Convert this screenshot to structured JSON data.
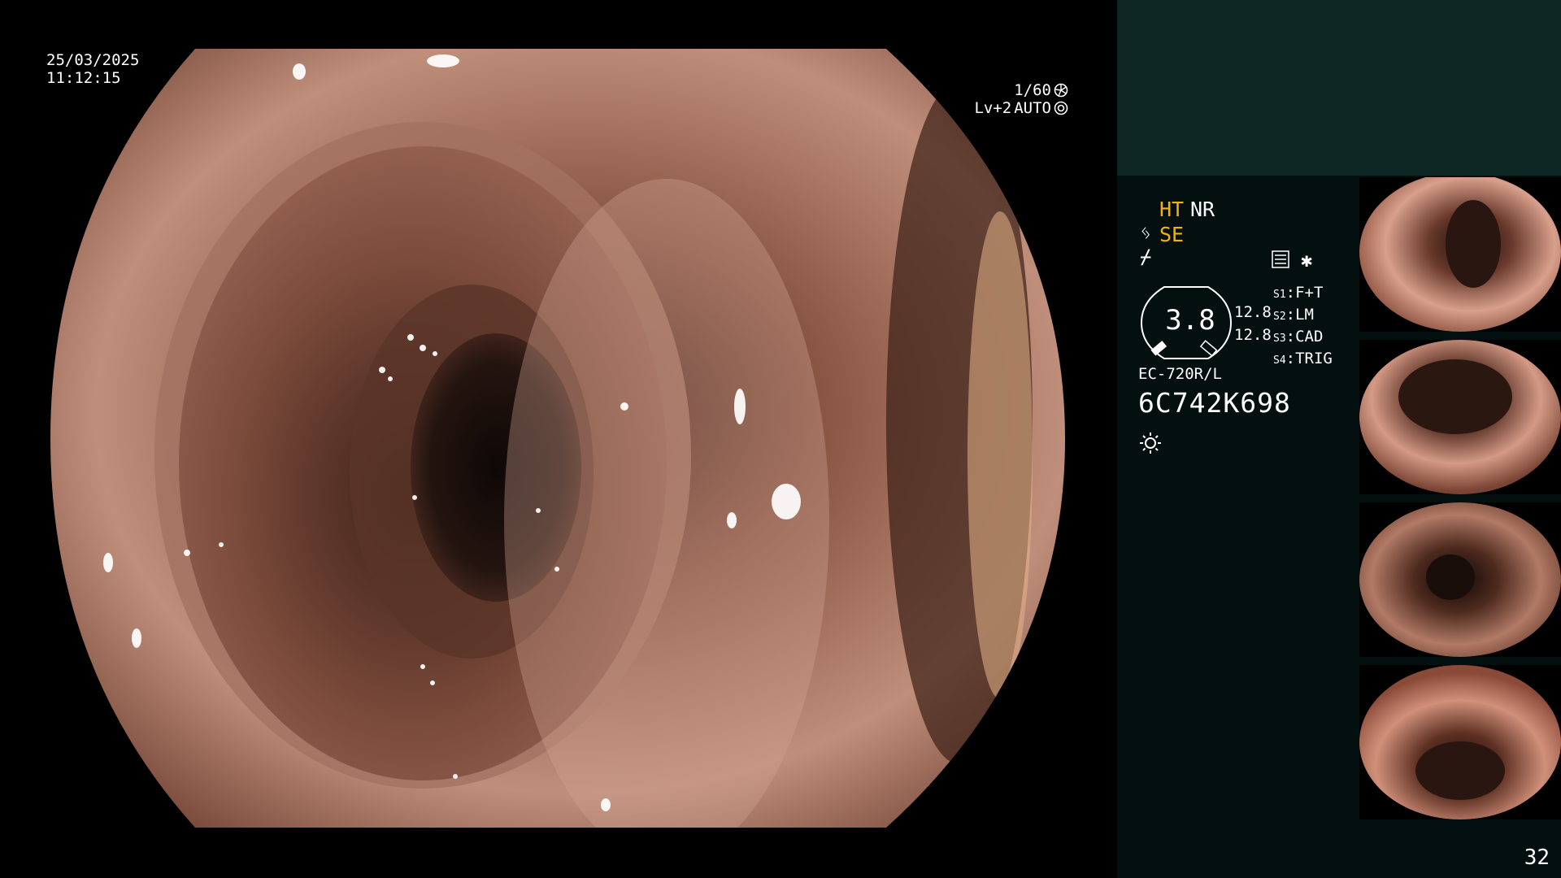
{
  "overlay": {
    "date": "25/03/2025",
    "time": "11:12:15",
    "shutter": "1/60",
    "level": "Lv+2",
    "exposure_mode": "AUTO"
  },
  "panel": {
    "ht_label": "HT",
    "nr_label": "NR",
    "se_label": "SE",
    "zoom_value": "3.8",
    "zoom_sub_1": "12.8",
    "zoom_sub_2": "12.8",
    "modes": [
      {
        "key": "S1",
        "value": "F+T"
      },
      {
        "key": "S2",
        "value": "LM"
      },
      {
        "key": "S3",
        "value": "CAD"
      },
      {
        "key": "S4",
        "value": "TRIG"
      }
    ],
    "scope_model": "EC-720R/L",
    "serial": "6C742K698",
    "frame_count": "32"
  },
  "icons": {
    "shutter": "shutter-icon",
    "iris": "iris-icon",
    "se_symbol": "structure-enhancement-icon",
    "check_symbol": "color-check-icon",
    "settings": "settings-list-icon",
    "asterisk": "asterisk-icon",
    "zoom": "zoom-dial-icon",
    "light": "light-source-icon"
  },
  "colors": {
    "accent": "#f2b400",
    "panel_bg": "#03100f",
    "panel_top": "#0c2624"
  },
  "thumbnails": [
    {
      "label": "thumbnail-1"
    },
    {
      "label": "thumbnail-2"
    },
    {
      "label": "thumbnail-3"
    },
    {
      "label": "thumbnail-4"
    }
  ]
}
